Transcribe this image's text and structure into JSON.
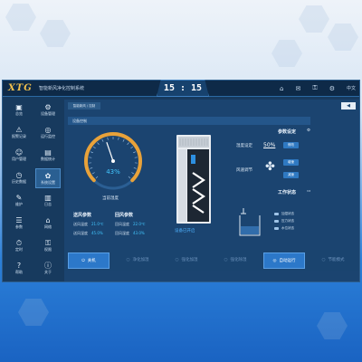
{
  "app": {
    "logo": "XTG",
    "title": "智能新风净化控制系统",
    "clock": "15 : 15"
  },
  "topbar": {
    "icons": [
      "home-icon",
      "mail-icon",
      "lock-icon",
      "settings-icon"
    ],
    "lang": "中文"
  },
  "sidebar": {
    "items": [
      {
        "label": "总览",
        "icon": "▣"
      },
      {
        "label": "设备管理",
        "icon": "⚙"
      },
      {
        "label": "报警记录",
        "icon": "⚠"
      },
      {
        "label": "运行监控",
        "icon": "◎"
      },
      {
        "label": "用户管理",
        "icon": "☺"
      },
      {
        "label": "数据统计",
        "icon": "▤"
      },
      {
        "label": "历史数据",
        "icon": "◷"
      },
      {
        "label": "系统设置",
        "icon": "✿",
        "active": true
      },
      {
        "label": "维护",
        "icon": "✎"
      },
      {
        "label": "日志",
        "icon": "▥"
      },
      {
        "label": "参数",
        "icon": "☰"
      },
      {
        "label": "网络",
        "icon": "⌂"
      },
      {
        "label": "定时",
        "icon": "⏱"
      },
      {
        "label": "权限",
        "icon": "⚿"
      },
      {
        "label": "帮助",
        "icon": "?"
      },
      {
        "label": "关于",
        "icon": "ⓘ"
      }
    ]
  },
  "main": {
    "breadcrumb": "智能新风 / 控制",
    "back": "◀",
    "panel_title": "设备控制",
    "gauge": {
      "value": 43,
      "unit": "%",
      "label": "当前湿度"
    },
    "fresh_air": {
      "title": "送风参数",
      "rows": [
        {
          "label": "送风温度",
          "value": "21.0℃"
        },
        {
          "label": "送风湿度",
          "value": "45.0%"
        }
      ]
    },
    "return_air": {
      "title": "回风参数",
      "rows": [
        {
          "label": "回风温度",
          "value": "22.0℃"
        },
        {
          "label": "回风湿度",
          "value": "43.0%"
        }
      ]
    },
    "device_status": "设备已开启",
    "params": {
      "title": "参数设定",
      "humidity_label": "湿度设定",
      "humidity_value": "50%",
      "humidity_button": "修改",
      "fan_label": "风速调节",
      "fan_up": "增速",
      "fan_down": "减速"
    },
    "work_status": {
      "title": "工作状态",
      "items": [
        "加湿状态",
        "压力状态",
        "水位状态"
      ]
    },
    "bottom_buttons": [
      {
        "label": "关机",
        "icon": "⏻",
        "on": true
      },
      {
        "label": "净化加湿",
        "icon": "○",
        "on": false
      },
      {
        "label": "强化加湿",
        "icon": "○",
        "on": false
      },
      {
        "label": "强化除湿",
        "icon": "○",
        "on": false
      },
      {
        "label": "自动运行",
        "icon": "◎",
        "on": true
      },
      {
        "label": "节能模式",
        "icon": "○",
        "on": false
      }
    ]
  },
  "colors": {
    "accent": "#2c78c9",
    "gauge_ring": "#e8a23a",
    "gauge_text": "#43c7ff"
  }
}
